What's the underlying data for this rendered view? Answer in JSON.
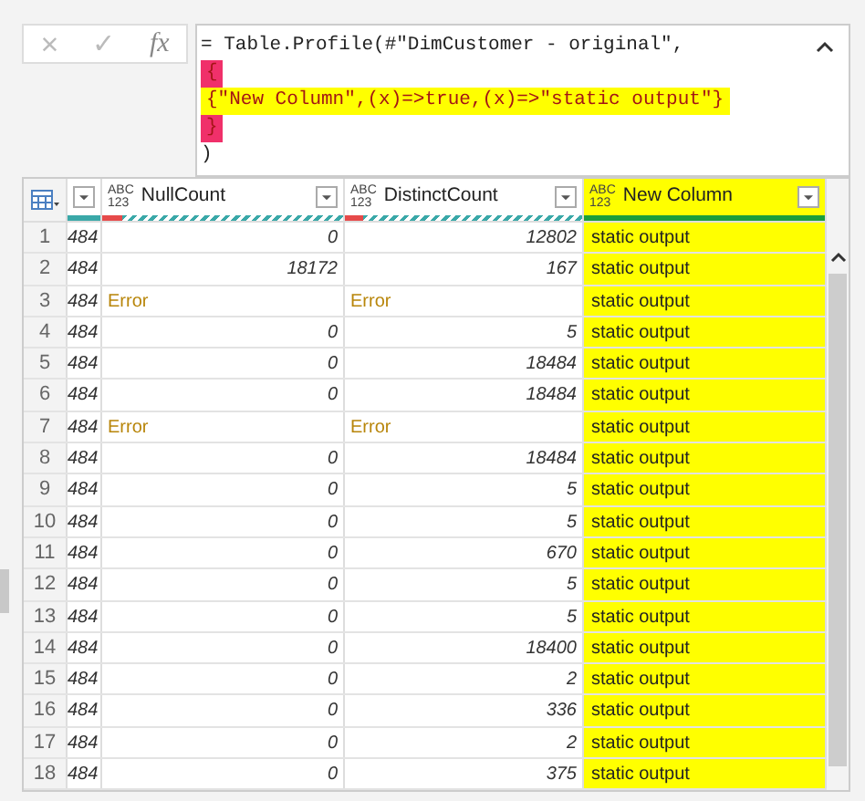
{
  "formula_bar": {
    "cancel": "×",
    "confirm": "✓",
    "fx": "fx",
    "lines": [
      {
        "text": "= Table.Profile(#\"DimCustomer - original\",",
        "kind": "plain"
      },
      {
        "text": "{",
        "kind": "bracket"
      },
      {
        "text": "{\"New Column\",(x)=>true,(x)=>\"static output\"}",
        "kind": "highlight"
      },
      {
        "text": "}",
        "kind": "bracket"
      },
      {
        "text": ")",
        "kind": "plain"
      }
    ]
  },
  "table": {
    "columns": [
      {
        "name": "NullCount",
        "type": "ABC\n123",
        "highlighted": false
      },
      {
        "name": "DistinctCount",
        "type": "ABC\n123",
        "highlighted": false
      },
      {
        "name": "New Column",
        "type": "ABC\n123",
        "highlighted": true
      }
    ],
    "rows": [
      {
        "number": "1",
        "column_1": "484",
        "null_count": "0",
        "distinct_count": "12802",
        "new_column": "static output",
        "error": false
      },
      {
        "number": "2",
        "column_1": "484",
        "null_count": "18172",
        "distinct_count": "167",
        "new_column": "static output",
        "error": false
      },
      {
        "number": "3",
        "column_1": "484",
        "null_count": "Error",
        "distinct_count": "Error",
        "new_column": "static output",
        "error": true
      },
      {
        "number": "4",
        "column_1": "484",
        "null_count": "0",
        "distinct_count": "5",
        "new_column": "static output",
        "error": false
      },
      {
        "number": "5",
        "column_1": "484",
        "null_count": "0",
        "distinct_count": "18484",
        "new_column": "static output",
        "error": false
      },
      {
        "number": "6",
        "column_1": "484",
        "null_count": "0",
        "distinct_count": "18484",
        "new_column": "static output",
        "error": false
      },
      {
        "number": "7",
        "column_1": "484",
        "null_count": "Error",
        "distinct_count": "Error",
        "new_column": "static output",
        "error": true
      },
      {
        "number": "8",
        "column_1": "484",
        "null_count": "0",
        "distinct_count": "18484",
        "new_column": "static output",
        "error": false
      },
      {
        "number": "9",
        "column_1": "484",
        "null_count": "0",
        "distinct_count": "5",
        "new_column": "static output",
        "error": false
      },
      {
        "number": "10",
        "column_1": "484",
        "null_count": "0",
        "distinct_count": "5",
        "new_column": "static output",
        "error": false
      },
      {
        "number": "11",
        "column_1": "484",
        "null_count": "0",
        "distinct_count": "670",
        "new_column": "static output",
        "error": false
      },
      {
        "number": "12",
        "column_1": "484",
        "null_count": "0",
        "distinct_count": "5",
        "new_column": "static output",
        "error": false
      },
      {
        "number": "13",
        "column_1": "484",
        "null_count": "0",
        "distinct_count": "5",
        "new_column": "static output",
        "error": false
      },
      {
        "number": "14",
        "column_1": "484",
        "null_count": "0",
        "distinct_count": "18400",
        "new_column": "static output",
        "error": false
      },
      {
        "number": "15",
        "column_1": "484",
        "null_count": "0",
        "distinct_count": "2",
        "new_column": "static output",
        "error": false
      },
      {
        "number": "16",
        "column_1": "484",
        "null_count": "0",
        "distinct_count": "336",
        "new_column": "static output",
        "error": false
      },
      {
        "number": "17",
        "column_1": "484",
        "null_count": "0",
        "distinct_count": "2",
        "new_column": "static output",
        "error": false
      },
      {
        "number": "18",
        "column_1": "484",
        "null_count": "0",
        "distinct_count": "375",
        "new_column": "static output",
        "error": false
      }
    ]
  }
}
